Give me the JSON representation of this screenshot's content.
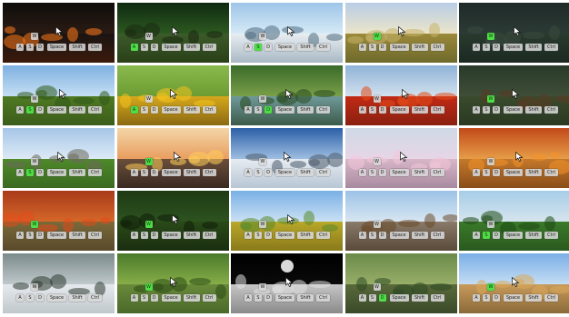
{
  "grid": {
    "cols": 5,
    "rows": 5
  },
  "key_labels": {
    "w": "W",
    "a": "A",
    "s": "S",
    "d": "D",
    "space": "Space",
    "shift": "Shift",
    "ctrl": "Ctrl"
  },
  "active_color": "#4fdc47",
  "tiles": [
    {
      "scene": "lava-field",
      "sky": [
        "#0f0d0c",
        "#2c1c14"
      ],
      "ground": [
        "#1a1412",
        "#3a1a0c"
      ],
      "accent": "#ff7a1a",
      "active": [],
      "cursor": true
    },
    {
      "scene": "forest-path",
      "sky": [
        "#0e2a10",
        "#2f5b22"
      ],
      "ground": [
        "#3c5a2a",
        "#2a4018"
      ],
      "accent": "#1a2a10",
      "active": [
        "a"
      ],
      "cursor": true
    },
    {
      "scene": "sea-cliffs",
      "sky": [
        "#9ec5e8",
        "#d9ecf7"
      ],
      "ground": [
        "#e8eef2",
        "#a9b8c4"
      ],
      "accent": "#4f6b80",
      "active": [
        "s"
      ],
      "cursor": true
    },
    {
      "scene": "golden-field",
      "sky": [
        "#b8cde6",
        "#efe6c8"
      ],
      "ground": [
        "#9b8a3a",
        "#6e6a2c"
      ],
      "accent": "#c4b36a",
      "active": [
        "w"
      ],
      "cursor": true
    },
    {
      "scene": "dark-forest",
      "sky": [
        "#1e2a28",
        "#2d3b36"
      ],
      "ground": [
        "#293a2e",
        "#1c2a22"
      ],
      "accent": "#3a4a3e",
      "active": [
        "w"
      ],
      "cursor": true
    },
    {
      "scene": "oak-grove",
      "sky": [
        "#7fb0e0",
        "#c9e2f5"
      ],
      "ground": [
        "#4f7a22",
        "#3b5d1a"
      ],
      "accent": "#2f5a1a",
      "active": [
        "s"
      ],
      "cursor": true
    },
    {
      "scene": "sunflowers",
      "sky": [
        "#8ab94e",
        "#6b9a30"
      ],
      "ground": [
        "#d7a81c",
        "#8b6a12"
      ],
      "accent": "#f2c21e",
      "active": [
        "a"
      ],
      "cursor": true
    },
    {
      "scene": "forest-stream",
      "sky": [
        "#3a6b2a",
        "#7da24a"
      ],
      "ground": [
        "#6f9a9a",
        "#3d5a4a"
      ],
      "accent": "#2a4a20",
      "active": [
        "d"
      ],
      "cursor": true
    },
    {
      "scene": "poppy-field",
      "sky": [
        "#8fb3d8",
        "#d6e3ee"
      ],
      "ground": [
        "#c22a14",
        "#8a2010"
      ],
      "accent": "#e24a1a",
      "active": [],
      "cursor": true
    },
    {
      "scene": "pine-woods",
      "sky": [
        "#2a3a2a",
        "#3f4f38"
      ],
      "ground": [
        "#3a4a2c",
        "#2a3a22"
      ],
      "accent": "#5a3a22",
      "active": [
        "w"
      ],
      "cursor": true
    },
    {
      "scene": "waterfall-valley",
      "sky": [
        "#a6c6e8",
        "#e0ecf6"
      ],
      "ground": [
        "#4f8a2a",
        "#3a6a20"
      ],
      "accent": "#6a6a5a",
      "active": [
        "s"
      ],
      "cursor": true
    },
    {
      "scene": "sunset-lake",
      "sky": [
        "#f4d6a8",
        "#e89a5a"
      ],
      "ground": [
        "#6a4e3a",
        "#3a2a22"
      ],
      "accent": "#ffce5a",
      "active": [
        "w"
      ],
      "cursor": true
    },
    {
      "scene": "snow-mountains",
      "sky": [
        "#2b5fa8",
        "#a6c4e4"
      ],
      "ground": [
        "#e6ecf2",
        "#b8c6d4"
      ],
      "accent": "#4a5a6a",
      "active": [],
      "cursor": true
    },
    {
      "scene": "cherry-blossom",
      "sky": [
        "#cfd8e6",
        "#e8d6e6"
      ],
      "ground": [
        "#d8b6c8",
        "#a88aa0"
      ],
      "accent": "#f2c6d8",
      "active": [],
      "cursor": true
    },
    {
      "scene": "autumn-woods",
      "sky": [
        "#c24a1a",
        "#e8a24a"
      ],
      "ground": [
        "#c4782a",
        "#8a4e1a"
      ],
      "accent": "#f2922a",
      "active": [],
      "cursor": true
    },
    {
      "scene": "red-autumn",
      "sky": [
        "#a83a1a",
        "#d86a2a"
      ],
      "ground": [
        "#7a6a3a",
        "#5a4a2a"
      ],
      "accent": "#e24a1a",
      "active": [
        "w"
      ],
      "cursor": false
    },
    {
      "scene": "jungle",
      "sky": [
        "#1e3a14",
        "#2e5420"
      ],
      "ground": [
        "#2a4a18",
        "#1a2e10"
      ],
      "accent": "#0e1e0a",
      "active": [
        "w"
      ],
      "cursor": true
    },
    {
      "scene": "meadow",
      "sky": [
        "#7ab0e6",
        "#cfe3f4"
      ],
      "ground": [
        "#b8a82a",
        "#8a7a1a"
      ],
      "accent": "#5a8a2a",
      "active": [],
      "cursor": true
    },
    {
      "scene": "old-village",
      "sky": [
        "#9cc2e6",
        "#dbe8f2"
      ],
      "ground": [
        "#8a7a6a",
        "#5a4a3a"
      ],
      "accent": "#6a4a2a",
      "active": [],
      "cursor": false
    },
    {
      "scene": "hedge-maze",
      "sky": [
        "#a6cde8",
        "#d8e6ee"
      ],
      "ground": [
        "#3a7a2a",
        "#2a5a1e"
      ],
      "accent": "#1e4a14",
      "active": [
        "s"
      ],
      "cursor": false
    },
    {
      "scene": "snowy-forest",
      "sky": [
        "#7a8a8a",
        "#c4ccd0"
      ],
      "ground": [
        "#e6eaee",
        "#c0c8cc"
      ],
      "accent": "#2e3a30",
      "active": [],
      "cursor": false
    },
    {
      "scene": "bamboo-forest",
      "sky": [
        "#4a7a2a",
        "#8ab04a"
      ],
      "ground": [
        "#6a8a3a",
        "#4a6a2a"
      ],
      "accent": "#2a4a14",
      "active": [
        "w"
      ],
      "cursor": true
    },
    {
      "scene": "moon-surface",
      "sky": [
        "#000000",
        "#0a0a0a"
      ],
      "ground": [
        "#c6c6c6",
        "#8a8a8a"
      ],
      "accent": "#e0e0e0",
      "active": [],
      "cursor": true
    },
    {
      "scene": "canyon-river",
      "sky": [
        "#6a8a4a",
        "#9ab06a"
      ],
      "ground": [
        "#5a6a3a",
        "#3a4a2a"
      ],
      "accent": "#2e4a22",
      "active": [
        "d"
      ],
      "cursor": false
    },
    {
      "scene": "village-street",
      "sky": [
        "#7aaee6",
        "#c8e0f4"
      ],
      "ground": [
        "#c89a5a",
        "#8a6a3a"
      ],
      "accent": "#d9a85a",
      "active": [
        "w"
      ],
      "cursor": true
    }
  ]
}
